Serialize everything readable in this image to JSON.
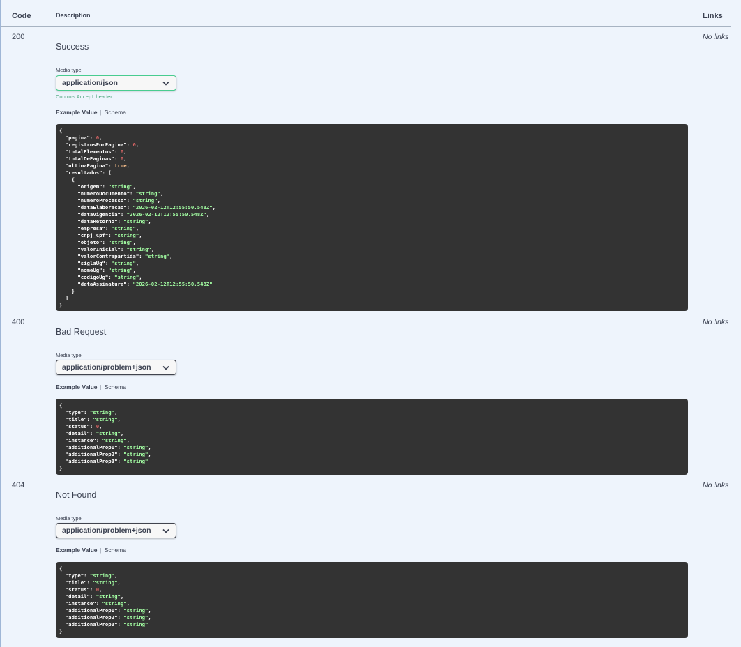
{
  "table": {
    "code_header": "Code",
    "description_header": "Description",
    "links_header": "Links"
  },
  "responses": [
    {
      "code": "200",
      "description": "Success",
      "links": "No links",
      "media_type_label": "Media type",
      "media_type": "application/json",
      "controls_prefix": "Controls ",
      "controls_code": "Accept",
      "controls_suffix": " header.",
      "tab_example": "Example Value",
      "tab_schema": "Schema",
      "example_lines": [
        [
          [
            "{",
            "k"
          ]
        ],
        [
          [
            "  \"pagina\": ",
            "k"
          ],
          [
            "0",
            "n"
          ],
          [
            ",",
            "k"
          ]
        ],
        [
          [
            "  \"registrosPorPagina\": ",
            "k"
          ],
          [
            "0",
            "n"
          ],
          [
            ",",
            "k"
          ]
        ],
        [
          [
            "  \"totalElementos\": ",
            "k"
          ],
          [
            "0",
            "n"
          ],
          [
            ",",
            "k"
          ]
        ],
        [
          [
            "  \"totalDePaginas\": ",
            "k"
          ],
          [
            "0",
            "n"
          ],
          [
            ",",
            "k"
          ]
        ],
        [
          [
            "  \"ultimaPagina\": ",
            "k"
          ],
          [
            "true",
            "b"
          ],
          [
            ",",
            "k"
          ]
        ],
        [
          [
            "  \"resultados\": [",
            "k"
          ]
        ],
        [
          [
            "    {",
            "k"
          ]
        ],
        [
          [
            "      \"origem\": ",
            "k"
          ],
          [
            "\"string\"",
            "s"
          ],
          [
            ",",
            "k"
          ]
        ],
        [
          [
            "      \"numeroDocumento\": ",
            "k"
          ],
          [
            "\"string\"",
            "s"
          ],
          [
            ",",
            "k"
          ]
        ],
        [
          [
            "      \"numeroProcesso\": ",
            "k"
          ],
          [
            "\"string\"",
            "s"
          ],
          [
            ",",
            "k"
          ]
        ],
        [
          [
            "      \"dataElaboracao\": ",
            "k"
          ],
          [
            "\"2026-02-12T12:55:50.548Z\"",
            "s"
          ],
          [
            ",",
            "k"
          ]
        ],
        [
          [
            "      \"dataVigencia\": ",
            "k"
          ],
          [
            "\"2026-02-12T12:55:50.548Z\"",
            "s"
          ],
          [
            ",",
            "k"
          ]
        ],
        [
          [
            "      \"dataRetorno\": ",
            "k"
          ],
          [
            "\"string\"",
            "s"
          ],
          [
            ",",
            "k"
          ]
        ],
        [
          [
            "      \"empresa\": ",
            "k"
          ],
          [
            "\"string\"",
            "s"
          ],
          [
            ",",
            "k"
          ]
        ],
        [
          [
            "      \"cnpj_Cpf\": ",
            "k"
          ],
          [
            "\"string\"",
            "s"
          ],
          [
            ",",
            "k"
          ]
        ],
        [
          [
            "      \"objeto\": ",
            "k"
          ],
          [
            "\"string\"",
            "s"
          ],
          [
            ",",
            "k"
          ]
        ],
        [
          [
            "      \"valorInicial\": ",
            "k"
          ],
          [
            "\"string\"",
            "s"
          ],
          [
            ",",
            "k"
          ]
        ],
        [
          [
            "      \"valorContrapartida\": ",
            "k"
          ],
          [
            "\"string\"",
            "s"
          ],
          [
            ",",
            "k"
          ]
        ],
        [
          [
            "      \"siglaUg\": ",
            "k"
          ],
          [
            "\"string\"",
            "s"
          ],
          [
            ",",
            "k"
          ]
        ],
        [
          [
            "      \"nomeUg\": ",
            "k"
          ],
          [
            "\"string\"",
            "s"
          ],
          [
            ",",
            "k"
          ]
        ],
        [
          [
            "      \"codigoUg\": ",
            "k"
          ],
          [
            "\"string\"",
            "s"
          ],
          [
            ",",
            "k"
          ]
        ],
        [
          [
            "      \"dataAssinatura\": ",
            "k"
          ],
          [
            "\"2026-02-12T12:55:50.548Z\"",
            "s"
          ]
        ],
        [
          [
            "    }",
            "k"
          ]
        ],
        [
          [
            "  ]",
            "k"
          ]
        ],
        [
          [
            "}",
            "k"
          ]
        ]
      ]
    },
    {
      "code": "400",
      "description": "Bad Request",
      "links": "No links",
      "media_type_label": "Media type",
      "media_type": "application/problem+json",
      "tab_example": "Example Value",
      "tab_schema": "Schema",
      "example_lines": [
        [
          [
            "{",
            "k"
          ]
        ],
        [
          [
            "  \"type\": ",
            "k"
          ],
          [
            "\"string\"",
            "s"
          ],
          [
            ",",
            "k"
          ]
        ],
        [
          [
            "  \"title\": ",
            "k"
          ],
          [
            "\"string\"",
            "s"
          ],
          [
            ",",
            "k"
          ]
        ],
        [
          [
            "  \"status\": ",
            "k"
          ],
          [
            "0",
            "n"
          ],
          [
            ",",
            "k"
          ]
        ],
        [
          [
            "  \"detail\": ",
            "k"
          ],
          [
            "\"string\"",
            "s"
          ],
          [
            ",",
            "k"
          ]
        ],
        [
          [
            "  \"instance\": ",
            "k"
          ],
          [
            "\"string\"",
            "s"
          ],
          [
            ",",
            "k"
          ]
        ],
        [
          [
            "  \"additionalProp1\": ",
            "k"
          ],
          [
            "\"string\"",
            "s"
          ],
          [
            ",",
            "k"
          ]
        ],
        [
          [
            "  \"additionalProp2\": ",
            "k"
          ],
          [
            "\"string\"",
            "s"
          ],
          [
            ",",
            "k"
          ]
        ],
        [
          [
            "  \"additionalProp3\": ",
            "k"
          ],
          [
            "\"string\"",
            "s"
          ]
        ],
        [
          [
            "}",
            "k"
          ]
        ]
      ]
    },
    {
      "code": "404",
      "description": "Not Found",
      "links": "No links",
      "media_type_label": "Media type",
      "media_type": "application/problem+json",
      "tab_example": "Example Value",
      "tab_schema": "Schema",
      "example_lines": [
        [
          [
            "{",
            "k"
          ]
        ],
        [
          [
            "  \"type\": ",
            "k"
          ],
          [
            "\"string\"",
            "s"
          ],
          [
            ",",
            "k"
          ]
        ],
        [
          [
            "  \"title\": ",
            "k"
          ],
          [
            "\"string\"",
            "s"
          ],
          [
            ",",
            "k"
          ]
        ],
        [
          [
            "  \"status\": ",
            "k"
          ],
          [
            "0",
            "n"
          ],
          [
            ",",
            "k"
          ]
        ],
        [
          [
            "  \"detail\": ",
            "k"
          ],
          [
            "\"string\"",
            "s"
          ],
          [
            ",",
            "k"
          ]
        ],
        [
          [
            "  \"instance\": ",
            "k"
          ],
          [
            "\"string\"",
            "s"
          ],
          [
            ",",
            "k"
          ]
        ],
        [
          [
            "  \"additionalProp1\": ",
            "k"
          ],
          [
            "\"string\"",
            "s"
          ],
          [
            ",",
            "k"
          ]
        ],
        [
          [
            "  \"additionalProp2\": ",
            "k"
          ],
          [
            "\"string\"",
            "s"
          ],
          [
            ",",
            "k"
          ]
        ],
        [
          [
            "  \"additionalProp3\": ",
            "k"
          ],
          [
            "\"string\"",
            "s"
          ]
        ],
        [
          [
            "}",
            "k"
          ]
        ]
      ]
    }
  ],
  "colors": {
    "background": "#eef4fc",
    "code_background": "#333333",
    "json_string": "#a2fca2",
    "json_number": "#d36363",
    "json_boolean": "#fcc28c",
    "active_select_border": "#49cc90"
  },
  "icons": {
    "select_chevron": "chevron-down-icon"
  }
}
